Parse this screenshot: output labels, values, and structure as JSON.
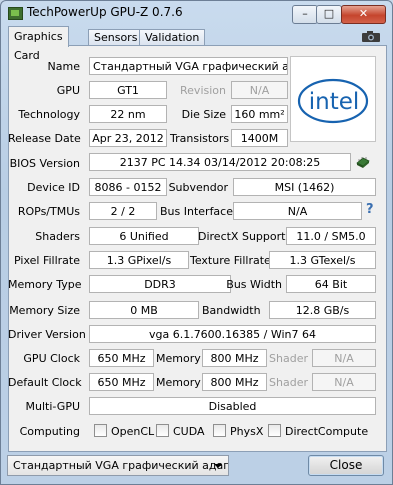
{
  "window": {
    "title": "TechPowerUp GPU-Z 0.7.6"
  },
  "tabs": [
    "Graphics Card",
    "Sensors",
    "Validation"
  ],
  "fields": {
    "name": {
      "label": "Name",
      "value": "Стандартный VGA графический адап..."
    },
    "gpu": {
      "label": "GPU",
      "value": "GT1"
    },
    "revision": {
      "label": "Revision",
      "value": "N/A"
    },
    "technology": {
      "label": "Technology",
      "value": "22 nm"
    },
    "die_size": {
      "label": "Die Size",
      "value": "160 mm²"
    },
    "release_date": {
      "label": "Release Date",
      "value": "Apr 23, 2012"
    },
    "transistors": {
      "label": "Transistors",
      "value": "1400M"
    },
    "bios_version": {
      "label": "BIOS Version",
      "value": "2137 PC 14.34  03/14/2012  20:08:25"
    },
    "device_id": {
      "label": "Device ID",
      "value": "8086 - 0152"
    },
    "subvendor": {
      "label": "Subvendor",
      "value": "MSI (1462)"
    },
    "rops_tmus": {
      "label": "ROPs/TMUs",
      "value": "2 / 2"
    },
    "bus_interface": {
      "label": "Bus Interface",
      "value": "N/A"
    },
    "shaders": {
      "label": "Shaders",
      "value": "6 Unified"
    },
    "directx": {
      "label": "DirectX Support",
      "value": "11.0 / SM5.0"
    },
    "pixel_fillrate": {
      "label": "Pixel Fillrate",
      "value": "1.3 GPixel/s"
    },
    "texture_fillrate": {
      "label": "Texture Fillrate",
      "value": "1.3 GTexel/s"
    },
    "memory_type": {
      "label": "Memory Type",
      "value": "DDR3"
    },
    "bus_width": {
      "label": "Bus Width",
      "value": "64 Bit"
    },
    "memory_size": {
      "label": "Memory Size",
      "value": "0 MB"
    },
    "bandwidth": {
      "label": "Bandwidth",
      "value": "12.8 GB/s"
    },
    "driver_version": {
      "label": "Driver Version",
      "value": "vga 6.1.7600.16385 / Win7 64"
    },
    "gpu_clock": {
      "label": "GPU Clock",
      "value": "650 MHz",
      "memory_label": "Memory",
      "memory_value": "800 MHz",
      "shader_label": "Shader",
      "shader_value": "N/A"
    },
    "default_clock": {
      "label": "Default Clock",
      "value": "650 MHz",
      "memory_label": "Memory",
      "memory_value": "800 MHz",
      "shader_label": "Shader",
      "shader_value": "N/A"
    },
    "multi_gpu": {
      "label": "Multi-GPU",
      "value": "Disabled"
    },
    "computing": {
      "label": "Computing",
      "options": [
        "OpenCL",
        "CUDA",
        "PhysX",
        "DirectCompute"
      ]
    }
  },
  "bus_help": "?",
  "logo_text": "intel",
  "footer": {
    "selected_card": "Стандартный VGA графический адапт",
    "close_label": "Close"
  },
  "icons": {
    "app": "gpu-z-icon",
    "camera": "camera-icon",
    "bios": "bios-chip-icon"
  }
}
